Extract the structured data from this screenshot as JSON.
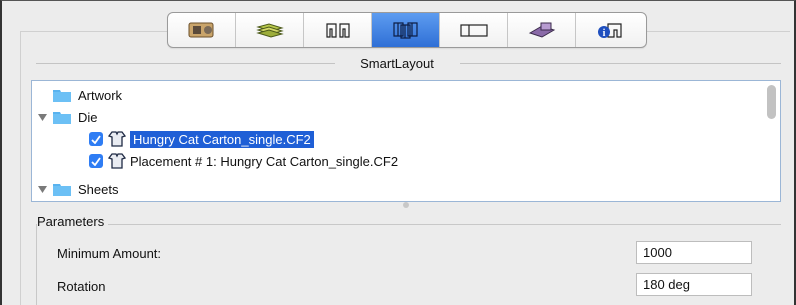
{
  "toolbar": {
    "buttons": [
      {
        "name": "job-info-icon",
        "active": false
      },
      {
        "name": "stock-sheet-icon",
        "active": false
      },
      {
        "name": "die-layout-icon",
        "active": false
      },
      {
        "name": "smart-layout-icon",
        "active": true
      },
      {
        "name": "sheet-layout-icon",
        "active": false
      },
      {
        "name": "press-icon",
        "active": false
      },
      {
        "name": "info-summary-icon",
        "active": false
      }
    ],
    "active_color": "#2f6fd6"
  },
  "group": {
    "title": "SmartLayout"
  },
  "tree": {
    "items": [
      {
        "label": "Artwork",
        "expanded": false,
        "icon": "folder-icon"
      },
      {
        "label": "Die",
        "expanded": true,
        "icon": "folder-icon"
      },
      {
        "label": "Hungry Cat Carton_single.CF2",
        "checked": true,
        "selected": true,
        "icon": "die-shirt-icon"
      },
      {
        "label": "Placement # 1: Hungry Cat Carton_single.CF2",
        "checked": true,
        "selected": false,
        "icon": "die-shirt-icon"
      },
      {
        "label": "Sheets",
        "expanded": true,
        "icon": "folder-icon"
      }
    ]
  },
  "parameters": {
    "title": "Parameters",
    "fields": [
      {
        "label": "Minimum Amount:",
        "value": "1000"
      },
      {
        "label": "Rotation",
        "value": "180 deg"
      }
    ]
  },
  "colors": {
    "folder": "#59b3ef",
    "checkbox": "#2f7df4",
    "selection": "#1f5fd6"
  }
}
